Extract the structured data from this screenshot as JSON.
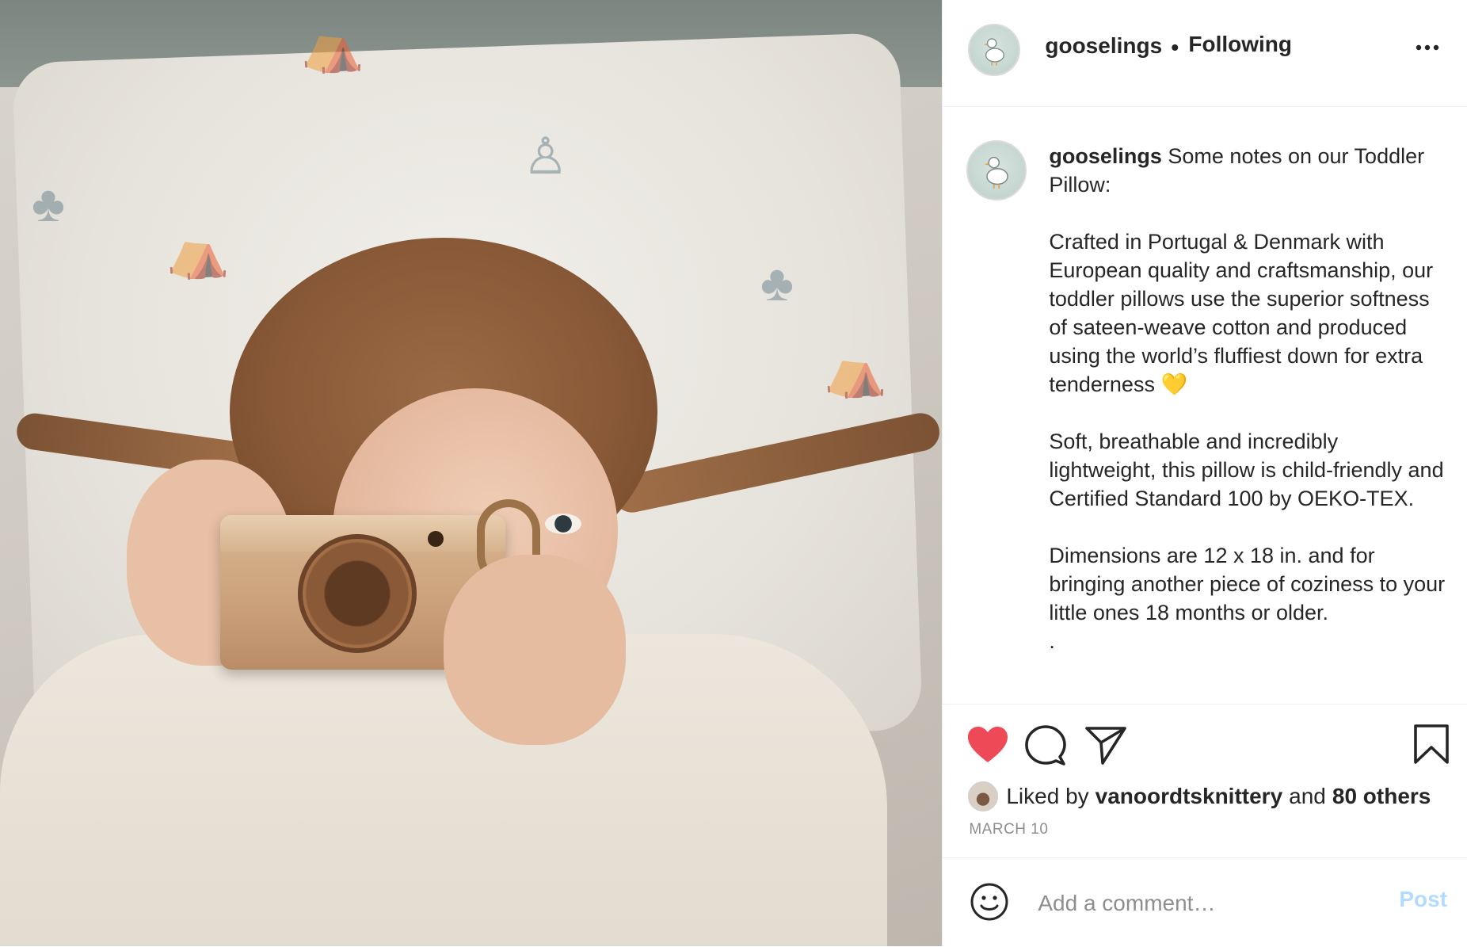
{
  "post": {
    "image_alt": "",
    "header": {
      "username": "gooselings",
      "separator": "•",
      "follow_status": "Following",
      "more_label": "•••"
    },
    "caption": {
      "username": "gooselings",
      "paragraphs": [
        "Some notes on our Toddler Pillow:",
        "Crafted in Portugal & Denmark with European quality and craftsmanship, our toddler pillows use the superior softness of sateen-weave cotton and produced using the world’s fluffiest down for extra tenderness 💛",
        "Soft, breathable and incredibly lightweight, this pillow is child-friendly and Certified Standard 100 by OEKO-TEX.",
        "Dimensions are 12 x 18 in. and for bringing another piece of coziness to your little ones 18 months or older.",
        "."
      ]
    },
    "actions": {
      "like_icon": "heart-icon",
      "comment_icon": "comment-icon",
      "share_icon": "paper-plane-icon",
      "save_icon": "bookmark-icon",
      "liked": true,
      "like_color": "#ed4956"
    },
    "likes": {
      "prefix": "Liked by",
      "liker": "vanoordtsknittery",
      "conjunction": "and",
      "others": "80 others"
    },
    "date": "MARCH 10",
    "comment_box": {
      "placeholder": "Add a comment…",
      "value": "",
      "post_label": "Post",
      "post_color": "#b3dbff"
    }
  }
}
